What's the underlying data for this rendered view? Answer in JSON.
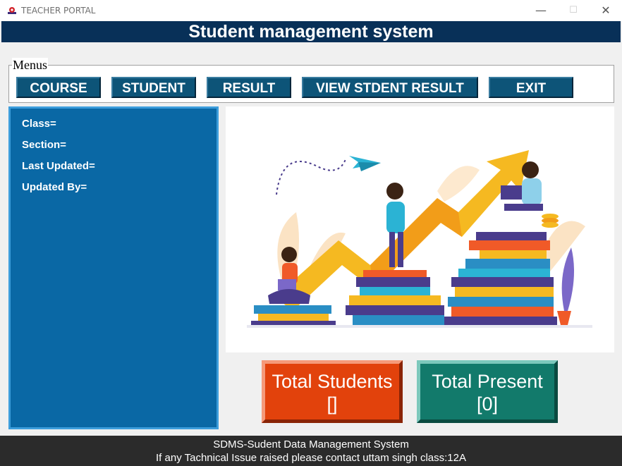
{
  "window": {
    "title": "TEACHER PORTAL",
    "minimize_glyph": "—",
    "maximize_glyph": "☐",
    "close_glyph": "✕"
  },
  "header": {
    "title": "Student management system"
  },
  "menus": {
    "legend": "Menus",
    "buttons": [
      "COURSE",
      "STUDENT",
      "RESULT",
      "VIEW STDENT RESULT",
      "EXIT"
    ]
  },
  "info": {
    "class_label": "Class=",
    "section_label": "Section=",
    "last_updated_label": "Last Updated=",
    "updated_by_label": "Updated By="
  },
  "stats": {
    "total_students_label": "Total Students",
    "total_students_value": "[]",
    "total_present_label": "Total Present",
    "total_present_value": "[0]"
  },
  "footer": {
    "line1": "SDMS-Sudent Data Management System",
    "line2": "If any Tachnical Issue raised please contact uttam singh class:12A"
  },
  "colors": {
    "header_bg": "#083058",
    "menu_button": "#0d5478",
    "info_panel": "#0a68a5",
    "total_students_bg": "#e2420c",
    "total_present_bg": "#127a6b",
    "footer_bg": "#2b2b2b"
  }
}
